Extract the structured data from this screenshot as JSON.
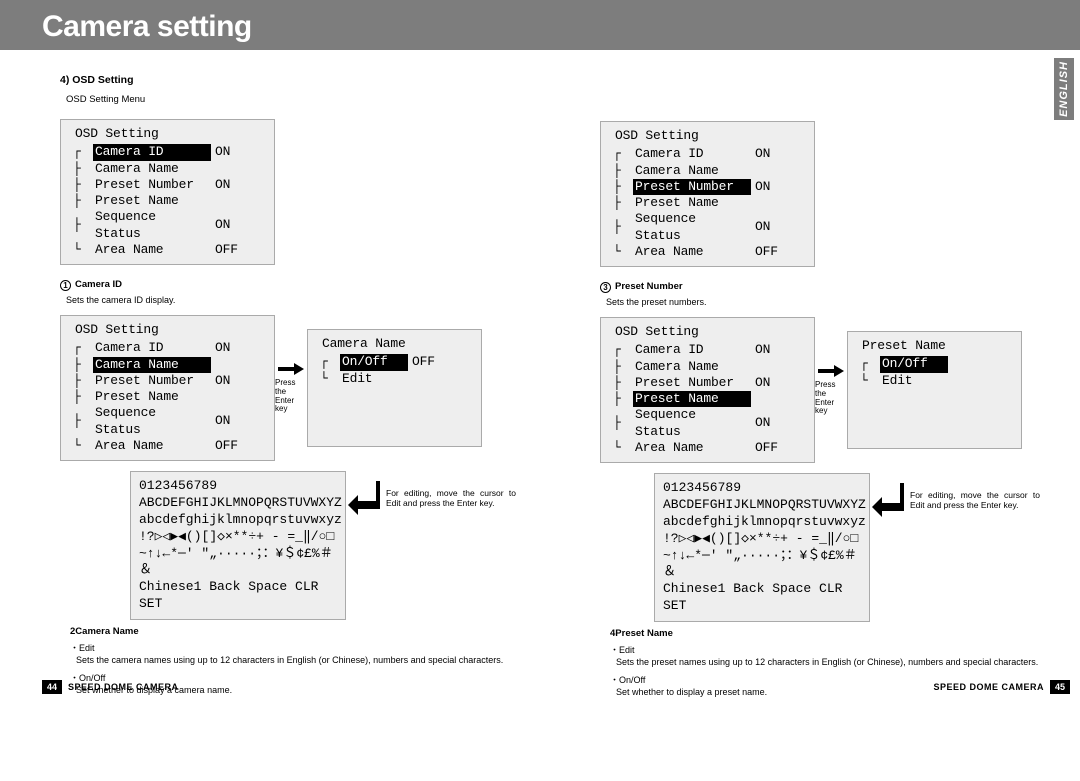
{
  "header": {
    "title": "Camera setting"
  },
  "lang_tab": "ENGLISH",
  "section_heading": "4) OSD Setting",
  "section_caption": "OSD Setting Menu",
  "osd_title": "OSD Setting",
  "items": {
    "camera_id": "Camera ID",
    "camera_name": "Camera Name",
    "preset_number": "Preset Number",
    "preset_name": "Preset Name",
    "sequence_status": "Sequence Status",
    "area_name": "Area Name"
  },
  "vals": {
    "on": "ON",
    "off": "OFF"
  },
  "sub_panel": {
    "camera_name_title": "Camera Name",
    "preset_name_title": "Preset Name",
    "onoff": "On/Off",
    "edit": "Edit",
    "val_off": "OFF"
  },
  "arrow_note": "Press the\nEnter key",
  "editing_note": "For editing, move the cursor to Edit and press the Enter key.",
  "charmap": {
    "l1": "0123456789",
    "l2": "ABCDEFGHIJKLMNOPQRSTUVWXYZ",
    "l3": "abcdefghijklmnopqrstuvwxyz",
    "l4": "!?▷◁▶◀()[]◇×**÷+ - =_‖/○□",
    "l5": "~↑↓←*─' ″„·····；：¥＄¢£%＃＆",
    "l6": "Chinese1 Back Space CLR SET"
  },
  "notes": {
    "n1_head": "Camera ID",
    "n1_body": "Sets the camera ID display.",
    "n2_head": "Camera Name",
    "n2_edit_l": "Edit",
    "n2_edit_b": "Sets the camera names using up to 12 characters in English (or Chinese), numbers and special characters.",
    "n2_onoff_l": "On/Off",
    "n2_onoff_b": "Set whether to display a camera name.",
    "n3_head": "Preset Number",
    "n3_body": "Sets the preset numbers.",
    "n4_head": "Preset Name",
    "n4_edit_l": "Edit",
    "n4_edit_b": "Sets the preset names using up to 12 characters in English (or Chinese), numbers and special characters.",
    "n4_onoff_l": "On/Off",
    "n4_onoff_b": "Set whether to display a preset name."
  },
  "footer": {
    "label": "SPEED DOME CAMERA",
    "page_left": "44",
    "page_right": "45"
  }
}
